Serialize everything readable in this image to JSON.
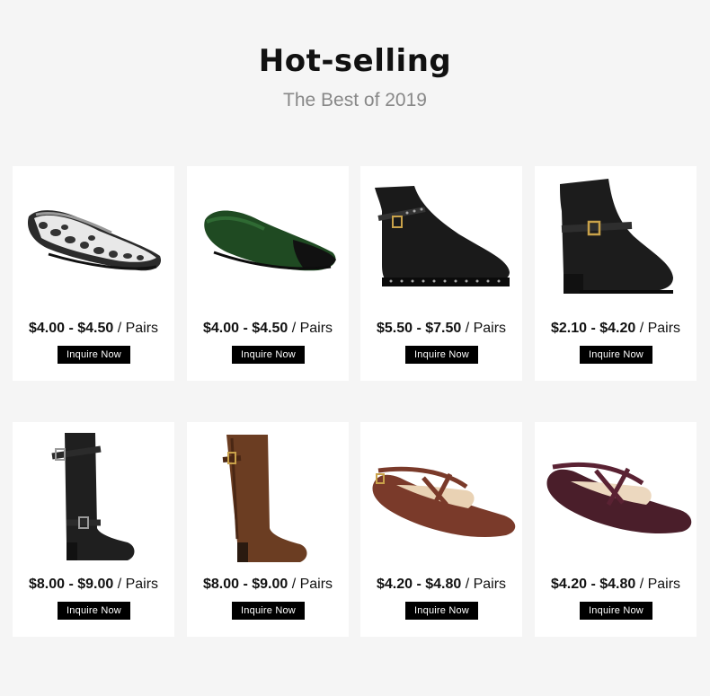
{
  "header": {
    "title": "Hot-selling",
    "subtitle": "The Best of 2019"
  },
  "products": [
    {
      "price_range": "$4.00 - $4.50",
      "unit": " / Pairs",
      "button": "Inquire Now",
      "image": "leopard-knit-flat-shoe"
    },
    {
      "price_range": "$4.00 - $4.50",
      "unit": " / Pairs",
      "button": "Inquire Now",
      "image": "green-knit-flat-shoe"
    },
    {
      "price_range": "$5.50 - $7.50",
      "unit": " / Pairs",
      "button": "Inquire Now",
      "image": "black-studded-ankle-boot"
    },
    {
      "price_range": "$2.10 - $4.20",
      "unit": " / Pairs",
      "button": "Inquire Now",
      "image": "black-buckle-ankle-boot"
    },
    {
      "price_range": "$8.00 - $9.00",
      "unit": " / Pairs",
      "button": "Inquire Now",
      "image": "black-knee-high-boot"
    },
    {
      "price_range": "$8.00 - $9.00",
      "unit": " / Pairs",
      "button": "Inquire Now",
      "image": "brown-knee-high-boot"
    },
    {
      "price_range": "$4.20 - $4.80",
      "unit": " / Pairs",
      "button": "Inquire Now",
      "image": "brown-strappy-flat-shoe"
    },
    {
      "price_range": "$4.20 - $4.80",
      "unit": " / Pairs",
      "button": "Inquire Now",
      "image": "burgundy-strappy-flat-shoe"
    }
  ]
}
